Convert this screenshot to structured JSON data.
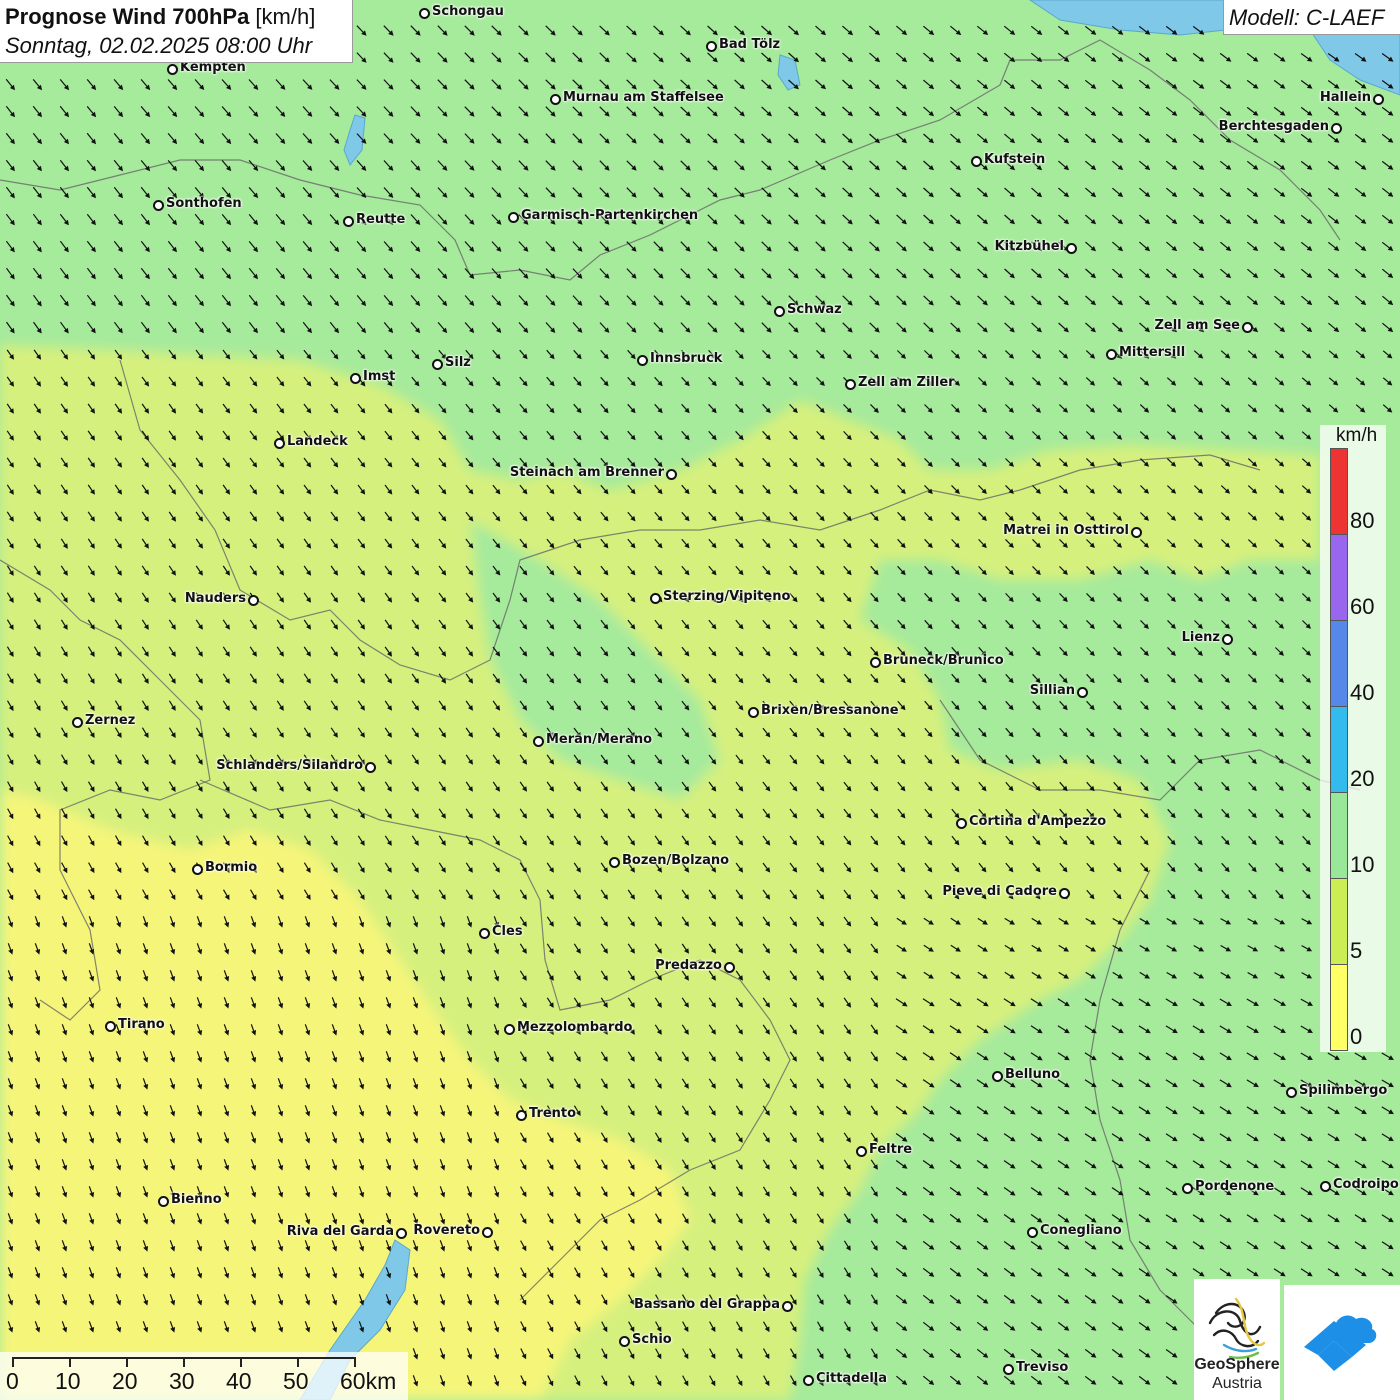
{
  "header": {
    "title_bold": "Prognose Wind 700hPa",
    "title_unit": " [km/h]",
    "datetime": "Sonntag, 02.02.2025 08:00 Uhr",
    "model": "Modell: C-LAEF"
  },
  "legend": {
    "unit": "km/h",
    "colors": [
      "#ffff66",
      "#ccee55",
      "#99e89a",
      "#33bbee",
      "#5588e8",
      "#9966ee",
      "#ee3333"
    ],
    "ticks": [
      "80",
      "60",
      "40",
      "20",
      "10",
      "5",
      "0"
    ]
  },
  "scale": {
    "labels": [
      "0",
      "10",
      "20",
      "30",
      "40",
      "50",
      "60km"
    ]
  },
  "logos": {
    "geosphere_line1": "GeoSphere",
    "geosphere_line2": "Austria"
  },
  "wind": {
    "prevailing_direction": "north-west",
    "colors": {
      "0-5": "#f5f57a",
      "5-10": "#d6f07e",
      "10-20": "#a6ea9c",
      "lakes": "#7fc8e8"
    }
  },
  "cities": [
    {
      "name": "Schongau",
      "align": "right"
    },
    {
      "name": "Bad Tölz",
      "align": "right"
    },
    {
      "name": "Kempten",
      "align": "right"
    },
    {
      "name": "Murnau am Staffelsee",
      "align": "right"
    },
    {
      "name": "Hallein",
      "align": "left"
    },
    {
      "name": "Berchtesgaden",
      "align": "left"
    },
    {
      "name": "Kufstein",
      "align": "right"
    },
    {
      "name": "Sonthofen",
      "align": "right"
    },
    {
      "name": "Reutte",
      "align": "right"
    },
    {
      "name": "Garmisch-Partenkirchen",
      "align": "right"
    },
    {
      "name": "Kitzbühel",
      "align": "left"
    },
    {
      "name": "Schwaz",
      "align": "right"
    },
    {
      "name": "Zell am See",
      "align": "left"
    },
    {
      "name": "Mittersill",
      "align": "right"
    },
    {
      "name": "Innsbruck",
      "align": "right"
    },
    {
      "name": "Silz",
      "align": "right"
    },
    {
      "name": "Imst",
      "align": "right"
    },
    {
      "name": "Zell am Ziller",
      "align": "right"
    },
    {
      "name": "Landeck",
      "align": "right"
    },
    {
      "name": "Steinach am Brenner",
      "align": "left"
    },
    {
      "name": "Matrei in Osttirol",
      "align": "left"
    },
    {
      "name": "Nauders",
      "align": "left"
    },
    {
      "name": "Sterzing/Vipiteno",
      "align": "right"
    },
    {
      "name": "Lienz",
      "align": "left"
    },
    {
      "name": "Bruneck/Brunico",
      "align": "right"
    },
    {
      "name": "Sillian",
      "align": "left"
    },
    {
      "name": "Brixen/Bressanone",
      "align": "right"
    },
    {
      "name": "Zernez",
      "align": "right"
    },
    {
      "name": "Meran/Merano",
      "align": "right"
    },
    {
      "name": "Schlanders/Silandro",
      "align": "left"
    },
    {
      "name": "Cortina d'Ampezzo",
      "align": "right"
    },
    {
      "name": "Bozen/Bolzano",
      "align": "right"
    },
    {
      "name": "Bormio",
      "align": "right"
    },
    {
      "name": "Pieve di Cadore",
      "align": "left"
    },
    {
      "name": "Cles",
      "align": "right"
    },
    {
      "name": "Predazzo",
      "align": "left"
    },
    {
      "name": "Tirano",
      "align": "right"
    },
    {
      "name": "Mezzolombardo",
      "align": "right"
    },
    {
      "name": "Belluno",
      "align": "right"
    },
    {
      "name": "Spilimbergo",
      "align": "right"
    },
    {
      "name": "Trento",
      "align": "right"
    },
    {
      "name": "Feltre",
      "align": "right"
    },
    {
      "name": "Pordenone",
      "align": "right"
    },
    {
      "name": "Codroipo",
      "align": "right"
    },
    {
      "name": "Bienno",
      "align": "right"
    },
    {
      "name": "Riva del Garda",
      "align": "left"
    },
    {
      "name": "Rovereto",
      "align": "left"
    },
    {
      "name": "Conegliano",
      "align": "right"
    },
    {
      "name": "Bassano del Grappa",
      "align": "left"
    },
    {
      "name": "Schio",
      "align": "right"
    },
    {
      "name": "Treviso",
      "align": "right"
    },
    {
      "name": "Cittadella",
      "align": "right"
    }
  ]
}
